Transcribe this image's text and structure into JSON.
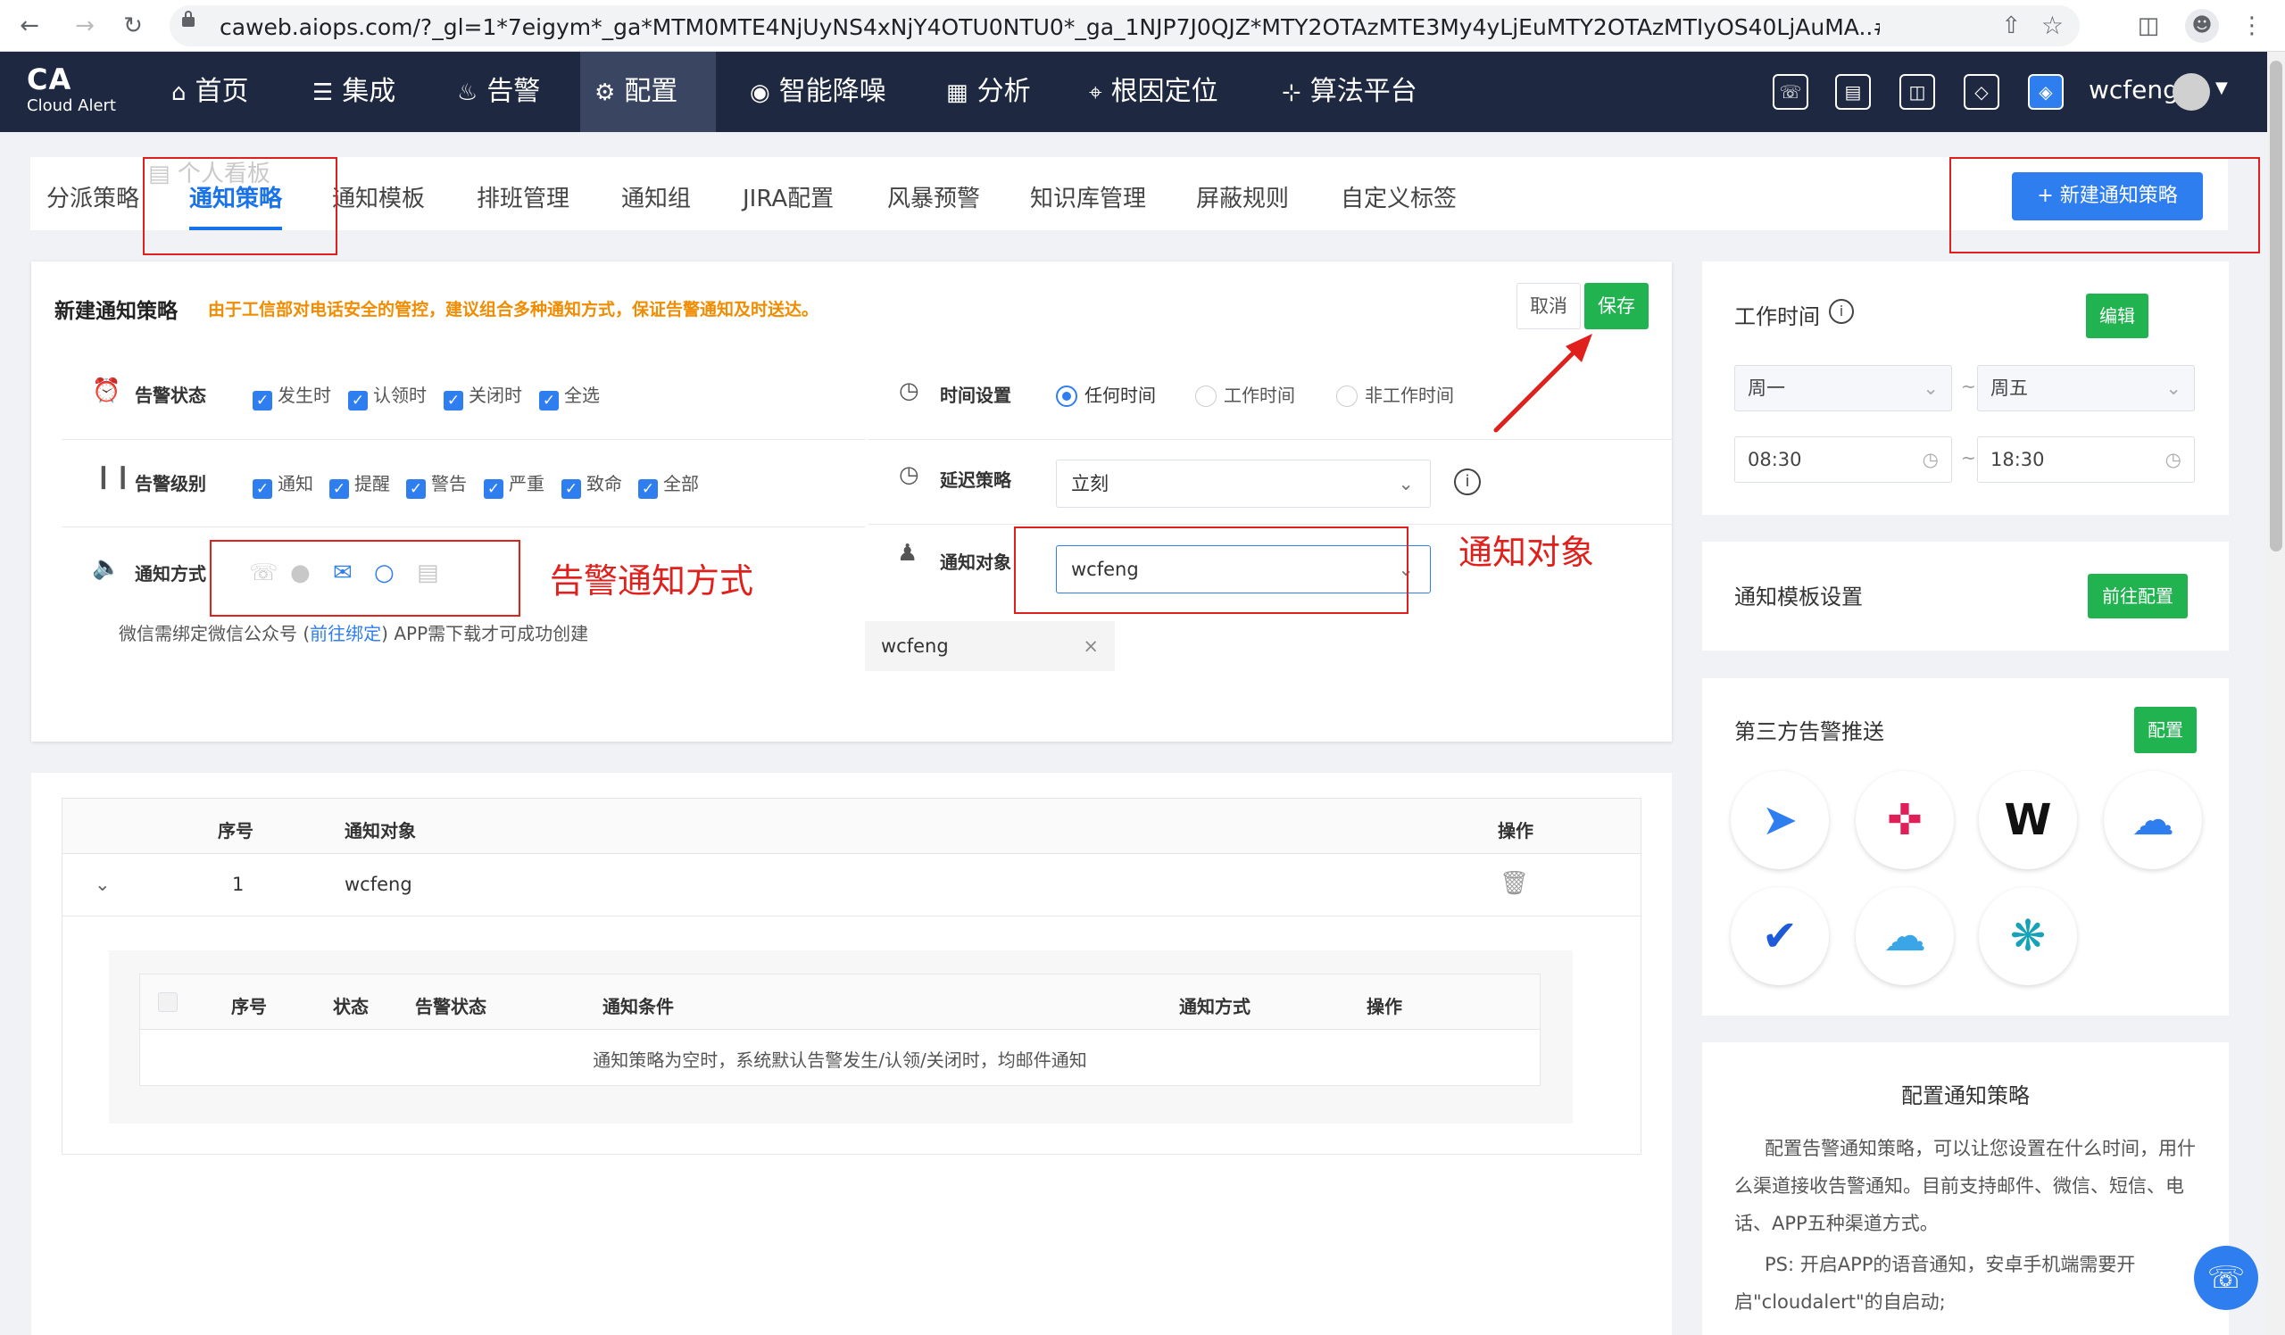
{
  "browser": {
    "url": "caweb.aiops.com/?_gl=1*7eigym*_ga*MTM0MTE4NjUyNS4xNjY4OTU0NTU0*_ga_1NJP7J0QJZ*MTY2OTAzMTE3My4yLjEuMTY2OTAzMTIyOS40LjAuMA..#/configure/notif...",
    "icons": [
      "back-icon",
      "forward-icon",
      "reload-icon",
      "lock-icon",
      "share-icon",
      "star-icon",
      "sidebar-icon",
      "profile-icon",
      "menu-icon"
    ]
  },
  "app": {
    "logo_main": "CA",
    "logo_sub": "Cloud Alert",
    "nav": [
      "首页",
      "集成",
      "告警",
      "配置",
      "智能降噪",
      "分析",
      "根因定位",
      "算法平台"
    ],
    "active_nav": "配置",
    "user": "wcfeng"
  },
  "tabs": [
    "分派策略",
    "通知策略",
    "通知模板",
    "排班管理",
    "通知组",
    "JIRA配置",
    "风暴预警",
    "知识库管理",
    "屏蔽规则",
    "自定义标签"
  ],
  "active_tab": "通知策略",
  "ghost_tab": "个人看板",
  "new_button": "+  新建通知策略",
  "form": {
    "title": "新建通知策略",
    "warning": "由于工信部对电话安全的管控，建议组合多种通知方式，保证告警通知及时送达。",
    "cancel": "取消",
    "save": "保存",
    "alert_state_label": "告警状态",
    "alert_states": [
      "发生时",
      "认领时",
      "关闭时",
      "全选"
    ],
    "alert_level_label": "告警级别",
    "alert_levels": [
      "通知",
      "提醒",
      "警告",
      "严重",
      "致命",
      "全部"
    ],
    "method_label": "通知方式",
    "note_prefix": "微信需绑定微信公众号 (",
    "note_link": "前往绑定",
    "note_suffix": ") APP需下载才可成功创建",
    "time_label": "时间设置",
    "time_options": [
      "任何时间",
      "工作时间",
      "非工作时间"
    ],
    "delay_label": "延迟策略",
    "delay_value": "立刻",
    "target_label": "通知对象",
    "target_value": "wcfeng",
    "tag_value": "wcfeng"
  },
  "annotations": {
    "method": "告警通知方式",
    "target": "通知对象"
  },
  "table": {
    "headers": [
      "序号",
      "通知对象",
      "操作"
    ],
    "rows": [
      {
        "index": "1",
        "target": "wcfeng"
      }
    ],
    "inner_headers": [
      "序号",
      "状态",
      "告警状态",
      "通知条件",
      "通知方式",
      "操作"
    ],
    "inner_empty": "通知策略为空时，系统默认告警发生/认领/关闭时，均邮件通知"
  },
  "worktime": {
    "title": "工作时间",
    "edit": "编辑",
    "day_from": "周一",
    "day_to": "周五",
    "time_from": "08:30",
    "time_to": "18:30",
    "sep": "~"
  },
  "template": {
    "title": "通知模板设置",
    "button": "前往配置"
  },
  "thirdparty": {
    "title": "第三方告警推送",
    "button": "配置",
    "logos": [
      "dingtalk-logo",
      "slack-logo",
      "wecom-w-logo",
      "chat-bubble-logo",
      "feishu-logo",
      "cloud-logo",
      "starburst-logo"
    ],
    "w_letter": "W"
  },
  "help": {
    "title": "配置通知策略",
    "p1": "配置告警通知策略，可以让您设置在什么时间，用什么渠道接收告警通知。目前支持邮件、微信、短信、电话、APP五种渠道方式。",
    "p2": "PS: 开启APP的语音通知，安卓手机端需要开启\"cloudalert\"的自启动;"
  },
  "colors": {
    "nav_bg": "#1e2840",
    "primary": "#2f7ef0",
    "success": "#21b34f",
    "warning": "#f08c00",
    "annotation": "#e0201c"
  }
}
